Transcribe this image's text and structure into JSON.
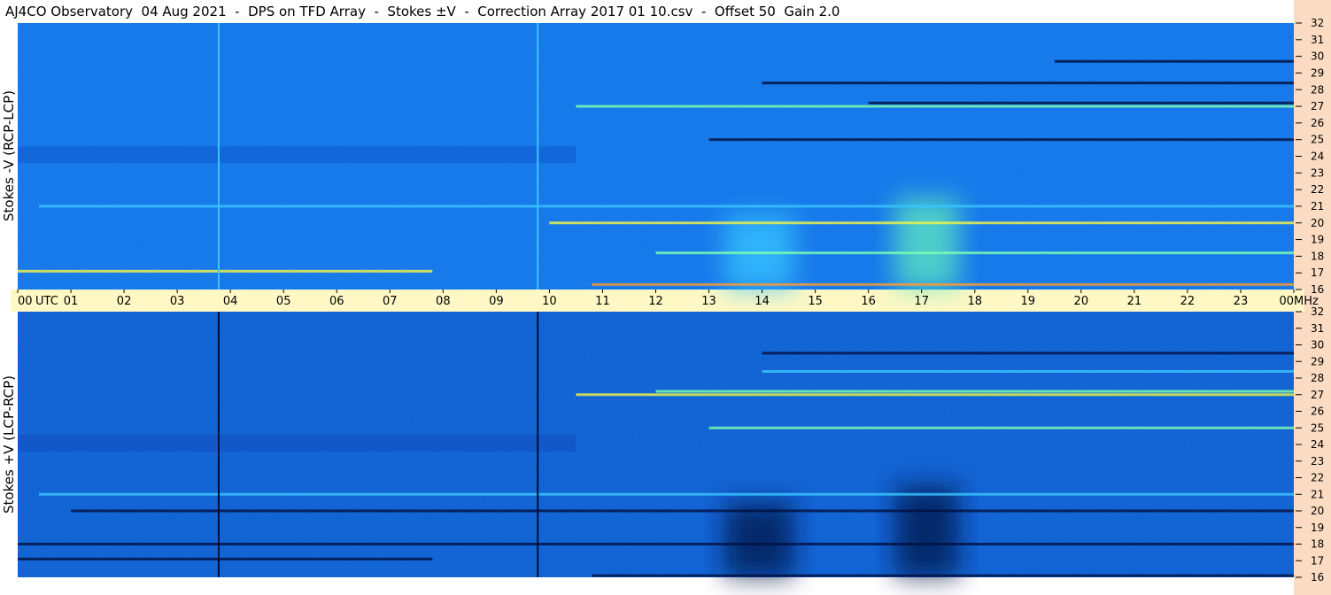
{
  "title": "AJ4CO Observatory  04 Aug 2021  -  DPS on TFD Array  -  Stokes ±V  -  Correction Array 2017 01 10.csv  -  Offset 50  Gain 2.0",
  "chart_data": [
    {
      "type": "heatmap",
      "ylabel": "Stokes -V  (RCP-LCP)",
      "x_ticks": [
        "00",
        "01",
        "02",
        "03",
        "04",
        "05",
        "06",
        "07",
        "08",
        "09",
        "10",
        "11",
        "12",
        "13",
        "14",
        "15",
        "16",
        "17",
        "18",
        "19",
        "20",
        "21",
        "22",
        "23",
        "00"
      ],
      "x_unit": "UTC",
      "y_ticks": [
        32,
        31,
        30,
        29,
        28,
        27,
        26,
        25,
        24,
        23,
        22,
        21,
        20,
        19,
        18,
        17,
        16
      ],
      "y_unit": "MHz",
      "ylim": [
        16,
        32
      ],
      "xlim_hours": [
        0,
        24
      ],
      "colormap": [
        "#001040",
        "#0055d0",
        "#1a73e8",
        "#39c6ff",
        "#7fffb0",
        "#f5f545",
        "#ff9a30"
      ],
      "background_color": "#1a73e8",
      "vertical_lines_utc": [
        3.78,
        9.78
      ],
      "vertical_line_color": "#39c6ff",
      "horizontal_band_mhz": [
        23.6,
        24.6
      ],
      "emission_bursts": [
        {
          "utc_start": 13.3,
          "utc_end": 14.6,
          "mhz_top": 20.5,
          "mhz_bottom": 16,
          "color": "#39c6ff"
        },
        {
          "utc_start": 16.5,
          "utc_end": 17.7,
          "mhz_top": 21.5,
          "mhz_bottom": 16,
          "color": "#5fe8c0"
        }
      ],
      "intensity_lines": [
        {
          "mhz": 27.0,
          "utc_start": 10.5,
          "utc_end": 24,
          "color": "#7fffb0"
        },
        {
          "mhz": 27.2,
          "utc_start": 16,
          "utc_end": 24,
          "color": "#001040"
        },
        {
          "mhz": 28.4,
          "utc_start": 14,
          "utc_end": 24,
          "color": "#001040"
        },
        {
          "mhz": 29.7,
          "utc_start": 19.5,
          "utc_end": 24,
          "color": "#001040"
        },
        {
          "mhz": 25.0,
          "utc_start": 13,
          "utc_end": 24,
          "color": "#001040"
        },
        {
          "mhz": 20.0,
          "utc_start": 10,
          "utc_end": 24,
          "color": "#f5f545"
        },
        {
          "mhz": 21.0,
          "utc_start": 0.4,
          "utc_end": 24,
          "color": "#39c6ff"
        },
        {
          "mhz": 18.2,
          "utc_start": 12,
          "utc_end": 24,
          "color": "#7fffb0"
        },
        {
          "mhz": 17.1,
          "utc_start": 0,
          "utc_end": 7.8,
          "color": "#f5f545"
        },
        {
          "mhz": 16.3,
          "utc_start": 10.8,
          "utc_end": 24,
          "color": "#ff9a30"
        }
      ]
    },
    {
      "type": "heatmap",
      "ylabel": "Stokes +V  (LCP-RCP)",
      "x_ticks": [
        "00",
        "01",
        "02",
        "03",
        "04",
        "05",
        "06",
        "07",
        "08",
        "09",
        "10",
        "11",
        "12",
        "13",
        "14",
        "15",
        "16",
        "17",
        "18",
        "19",
        "20",
        "21",
        "22",
        "23",
        "00"
      ],
      "x_unit": "UTC",
      "y_ticks": [
        32,
        31,
        30,
        29,
        28,
        27,
        26,
        25,
        24,
        23,
        22,
        21,
        20,
        19,
        18,
        17,
        16
      ],
      "y_unit": "MHz",
      "ylim": [
        16,
        32
      ],
      "xlim_hours": [
        0,
        24
      ],
      "colormap": [
        "#001040",
        "#0055d0",
        "#1a73e8",
        "#39c6ff",
        "#7fffb0",
        "#f5f545",
        "#ff9a30"
      ],
      "background_color": "#155fd2",
      "vertical_lines_utc": [
        3.78,
        9.78
      ],
      "vertical_line_color": "#001033",
      "horizontal_band_mhz": [
        23.6,
        24.6
      ],
      "emission_bursts": [
        {
          "utc_start": 13.3,
          "utc_end": 14.6,
          "mhz_top": 20.5,
          "mhz_bottom": 16,
          "color": "#03194a"
        },
        {
          "utc_start": 16.5,
          "utc_end": 17.7,
          "mhz_top": 21.5,
          "mhz_bottom": 16,
          "color": "#03194a"
        }
      ],
      "intensity_lines": [
        {
          "mhz": 27.0,
          "utc_start": 10.5,
          "utc_end": 24,
          "color": "#f5f545"
        },
        {
          "mhz": 27.2,
          "utc_start": 12,
          "utc_end": 24,
          "color": "#7fffb0"
        },
        {
          "mhz": 28.4,
          "utc_start": 14,
          "utc_end": 24,
          "color": "#39c6ff"
        },
        {
          "mhz": 29.5,
          "utc_start": 14,
          "utc_end": 24,
          "color": "#001040"
        },
        {
          "mhz": 25.0,
          "utc_start": 13,
          "utc_end": 24,
          "color": "#7fffb0"
        },
        {
          "mhz": 20.0,
          "utc_start": 1,
          "utc_end": 24,
          "color": "#001040"
        },
        {
          "mhz": 21.0,
          "utc_start": 0.4,
          "utc_end": 24,
          "color": "#39c6ff"
        },
        {
          "mhz": 18.0,
          "utc_start": 0,
          "utc_end": 24,
          "color": "#001040"
        },
        {
          "mhz": 17.1,
          "utc_start": 0,
          "utc_end": 7.8,
          "color": "#001040"
        },
        {
          "mhz": 16.1,
          "utc_start": 10.8,
          "utc_end": 24,
          "color": "#001040"
        }
      ]
    }
  ]
}
